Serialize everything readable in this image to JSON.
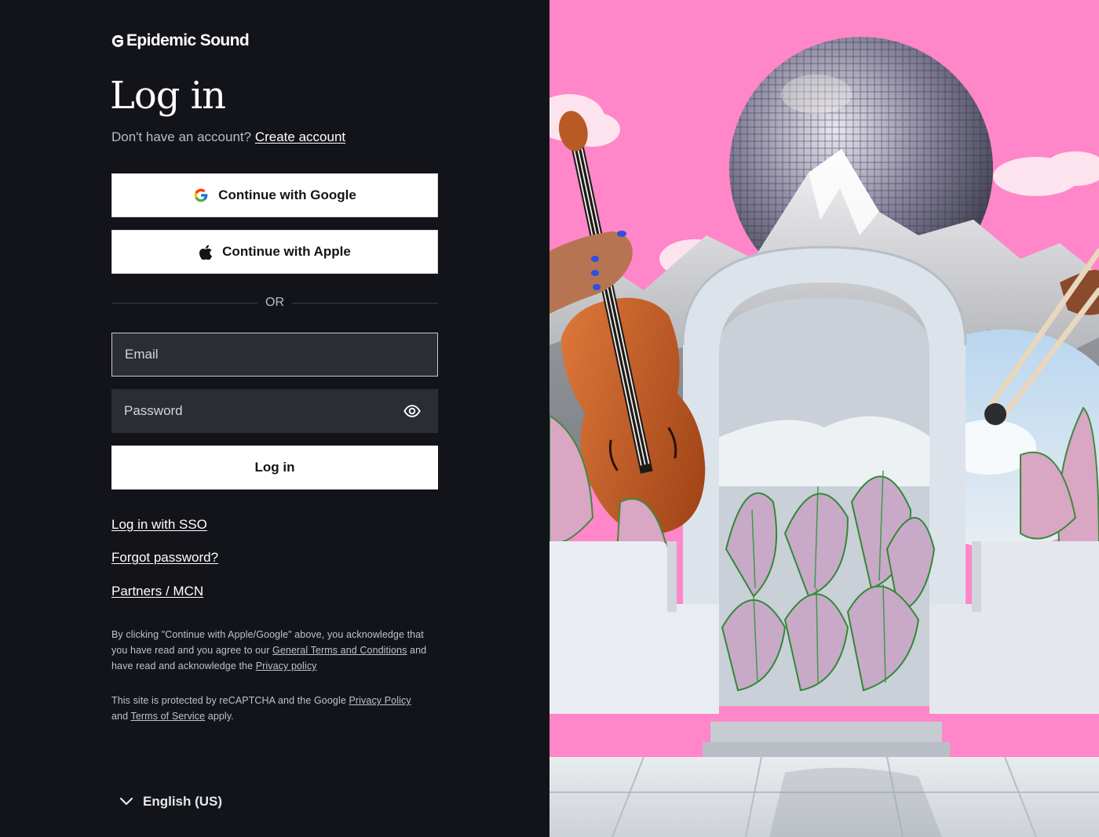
{
  "brand": {
    "name": "Epidemic Sound"
  },
  "heading": "Log in",
  "signup_prompt": {
    "text": "Don't have an account?",
    "link": "Create account"
  },
  "social": {
    "google_label": "Continue with Google",
    "apple_label": "Continue with Apple"
  },
  "divider_text": "OR",
  "form": {
    "email_placeholder": "Email",
    "email_value": "",
    "password_placeholder": "Password",
    "password_value": "",
    "submit_label": "Log in"
  },
  "links": {
    "sso": "Log in with SSO",
    "forgot": "Forgot password?",
    "partners": "Partners / MCN"
  },
  "legal": {
    "consent_pre": "By clicking \"Continue with Apple/Google\" above, you acknowledge that you have read and you agree to our",
    "terms_link": "General Terms and Conditions",
    "consent_mid": "and have read and acknowledge the",
    "privacy_link": "Privacy policy",
    "recaptcha_pre": "This site is protected by reCAPTCHA and the Google",
    "recaptcha_privacy": "Privacy Policy",
    "recaptcha_and": "and",
    "recaptcha_terms": "Terms of Service",
    "recaptcha_post": "apply."
  },
  "language": {
    "selected": "English (US)"
  },
  "icons": {
    "logo": "epidemic-sound-logo-icon",
    "google": "google-icon",
    "apple": "apple-icon",
    "password_toggle": "eye-icon",
    "language_toggle": "chevron-down-icon"
  },
  "colors": {
    "background": "#131419",
    "field_bg": "#2b2d35",
    "hero_pink": "#ff86c8",
    "text_muted": "#b9bcc4"
  }
}
